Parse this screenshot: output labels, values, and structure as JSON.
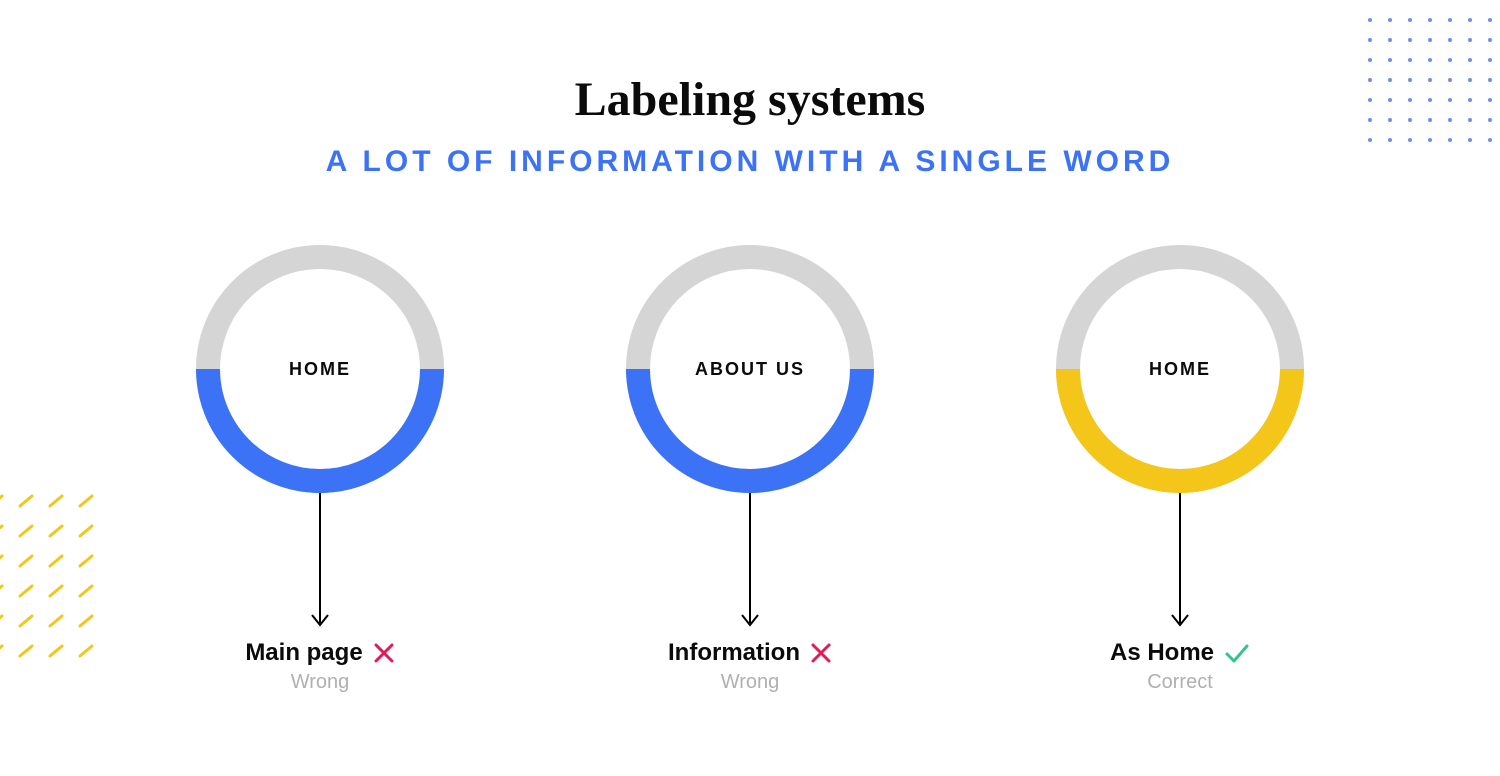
{
  "title": "Labeling systems",
  "subtitle": "A lot of information with a single word",
  "colors": {
    "blue": "#3b72f6",
    "yellow": "#f5c61a",
    "grey": "#d5d5d5",
    "red": "#e01b57",
    "green": "#38c28b",
    "textGrey": "#b0b0b0"
  },
  "items": [
    {
      "ring_label": "HOME",
      "ring_color": "blue",
      "result": "Main page",
      "correct": false,
      "caption": "Wrong"
    },
    {
      "ring_label": "ABOUT US",
      "ring_color": "blue",
      "result": "Information",
      "correct": false,
      "caption": "Wrong"
    },
    {
      "ring_label": "HOME",
      "ring_color": "yellow",
      "result": "As Home",
      "correct": true,
      "caption": "Correct"
    }
  ]
}
